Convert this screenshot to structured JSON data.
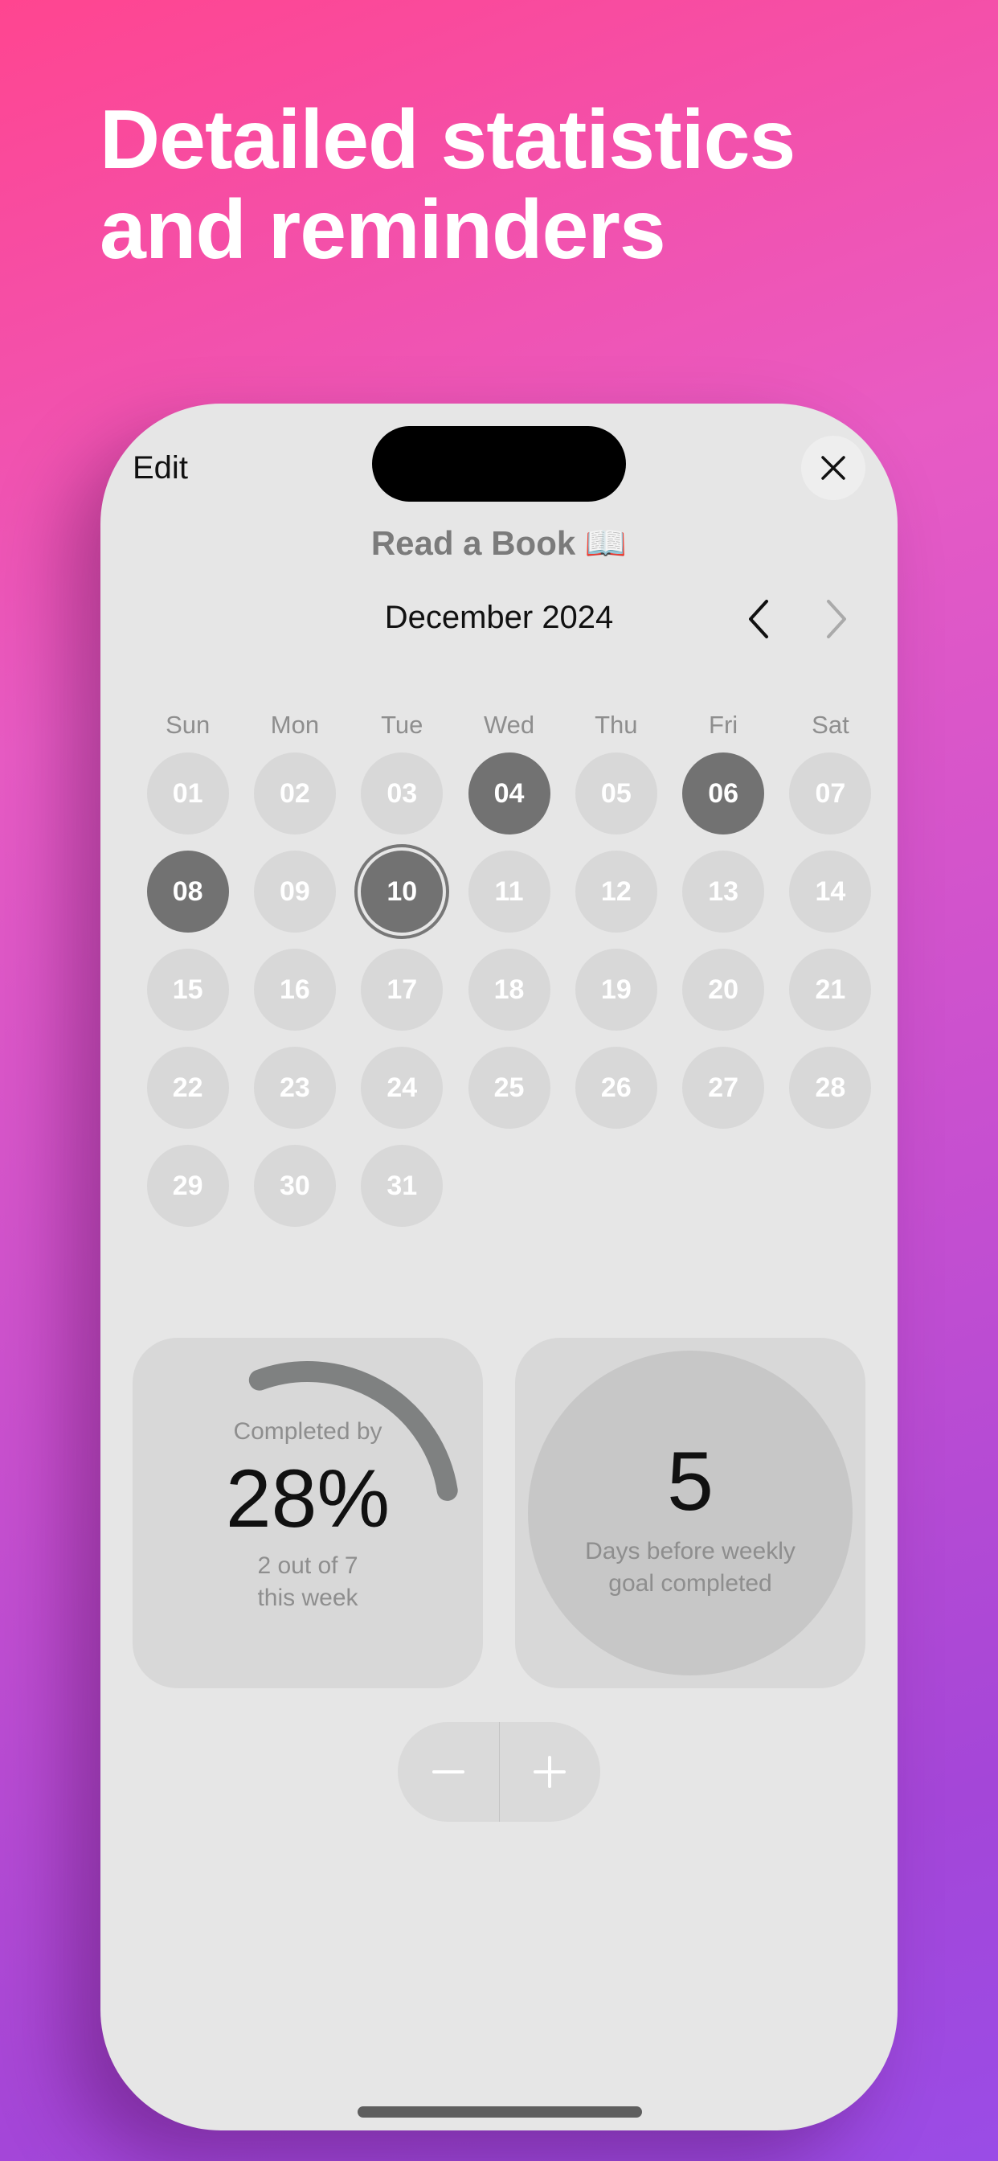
{
  "headline": {
    "line1": "Detailed statistics",
    "line2": "and reminders"
  },
  "nav": {
    "edit_label": "Edit",
    "close_icon": "close-icon"
  },
  "habit": {
    "title": "Read a Book 📖"
  },
  "calendar": {
    "month_label": "December 2024",
    "prev_icon": "chevron-left-icon",
    "next_icon": "chevron-right-icon",
    "weekdays": [
      "Sun",
      "Mon",
      "Tue",
      "Wed",
      "Thu",
      "Fri",
      "Sat"
    ],
    "days": [
      "01",
      "02",
      "03",
      "04",
      "05",
      "06",
      "07",
      "08",
      "09",
      "10",
      "11",
      "12",
      "13",
      "14",
      "15",
      "16",
      "17",
      "18",
      "19",
      "20",
      "21",
      "22",
      "23",
      "24",
      "25",
      "26",
      "27",
      "28",
      "29",
      "30",
      "31"
    ],
    "completed_days": [
      "04",
      "06",
      "08"
    ],
    "today": "10"
  },
  "stats": {
    "completed_label": "Completed by",
    "percent": "28%",
    "progress_fraction": 0.28,
    "count_line1": "2 out of 7",
    "count_line2": "this week",
    "goal_number": "5",
    "goal_line1": "Days before weekly",
    "goal_line2": "goal completed"
  },
  "stepper": {
    "minus_icon": "minus-icon",
    "plus_icon": "plus-icon"
  },
  "colors": {
    "done": "#727272",
    "pending": "#d8d8d8",
    "card": "#d8d8d8",
    "ring": "#7f8181",
    "bg_gradient_start": "#ff4590",
    "bg_gradient_end": "#9a4ce6"
  }
}
